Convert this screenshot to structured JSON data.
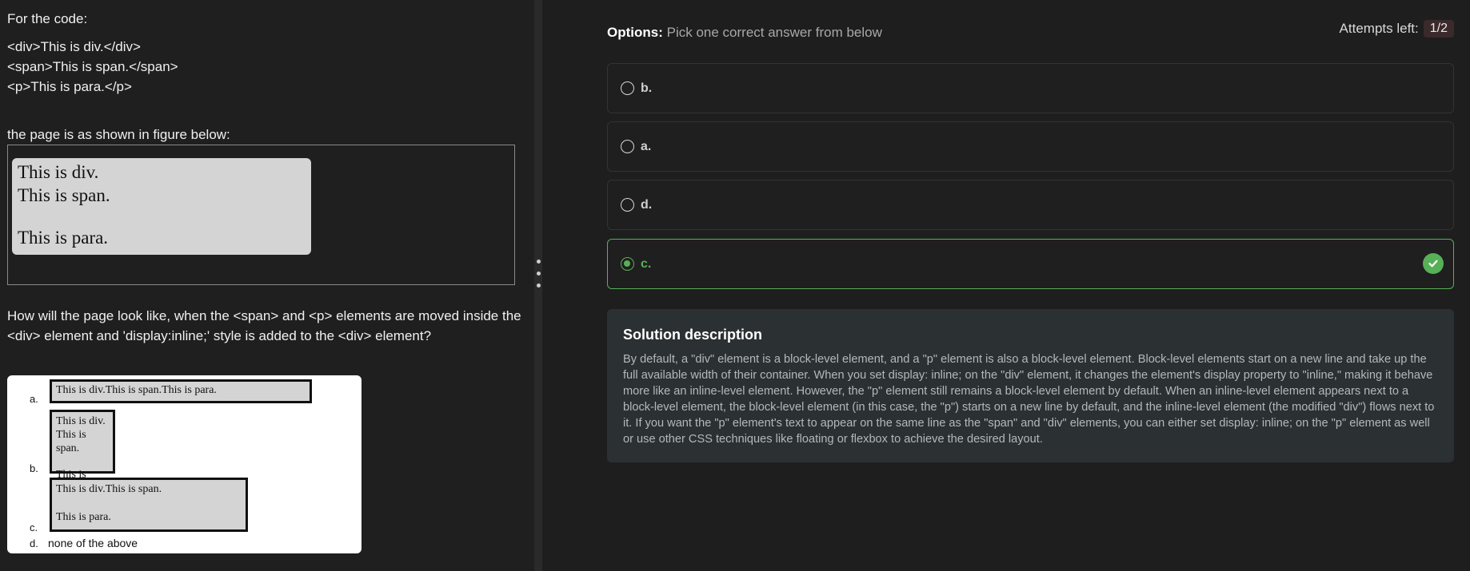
{
  "question": {
    "intro": "For the code:",
    "code_lines": [
      "<div>This is div.</div>",
      "<span>This is span.</span>",
      "<p>This is para.</p>"
    ],
    "figure_caption": "the page is as shown in figure below:",
    "figure_lines": [
      "This is div.",
      "This is span.",
      "This is para."
    ],
    "prompt": "How will the page look like, when the <span> and <p> elements are moved inside the <div> element and 'display:inline;' style is added to the <div> element?",
    "image_options": {
      "a": {
        "letter": "a.",
        "text": "This is div.This is span.This is para."
      },
      "b": {
        "letter": "b.",
        "lines": [
          "This is div.",
          "This is span.",
          "This is para."
        ]
      },
      "c": {
        "letter": "c.",
        "lines": [
          "This is div.This is span.",
          "This is para."
        ]
      },
      "d": {
        "letter": "d.",
        "text": "none of the above"
      }
    }
  },
  "options_panel": {
    "header_bold": "Options:",
    "header_muted": "Pick one correct answer from below",
    "attempts_label": "Attempts left:",
    "attempts_value": "1/2",
    "choices": [
      {
        "label": "b.",
        "selected": false
      },
      {
        "label": "a.",
        "selected": false
      },
      {
        "label": "d.",
        "selected": false
      },
      {
        "label": "c.",
        "selected": true,
        "correct": true
      }
    ],
    "correct_color": "#57b058"
  },
  "solution": {
    "title": "Solution description",
    "body": "By default, a \"div\" element is a block-level element, and a \"p\" element is also a block-level element. Block-level elements start on a new line and take up the full available width of their container. When you set display: inline; on the \"div\" element, it changes the element's display property to \"inline,\" making it behave more like an inline-level element. However, the \"p\" element still remains a block-level element by default. When an inline-level element appears next to a block-level element, the block-level element (in this case, the \"p\") starts on a new line by default, and the inline-level element (the modified \"div\") flows next to it. If you want the \"p\" element's text to appear on the same line as the \"span\" and \"div\" elements, you can either set display: inline; on the \"p\" element as well or use other CSS techniques like floating or flexbox to achieve the desired layout."
  }
}
